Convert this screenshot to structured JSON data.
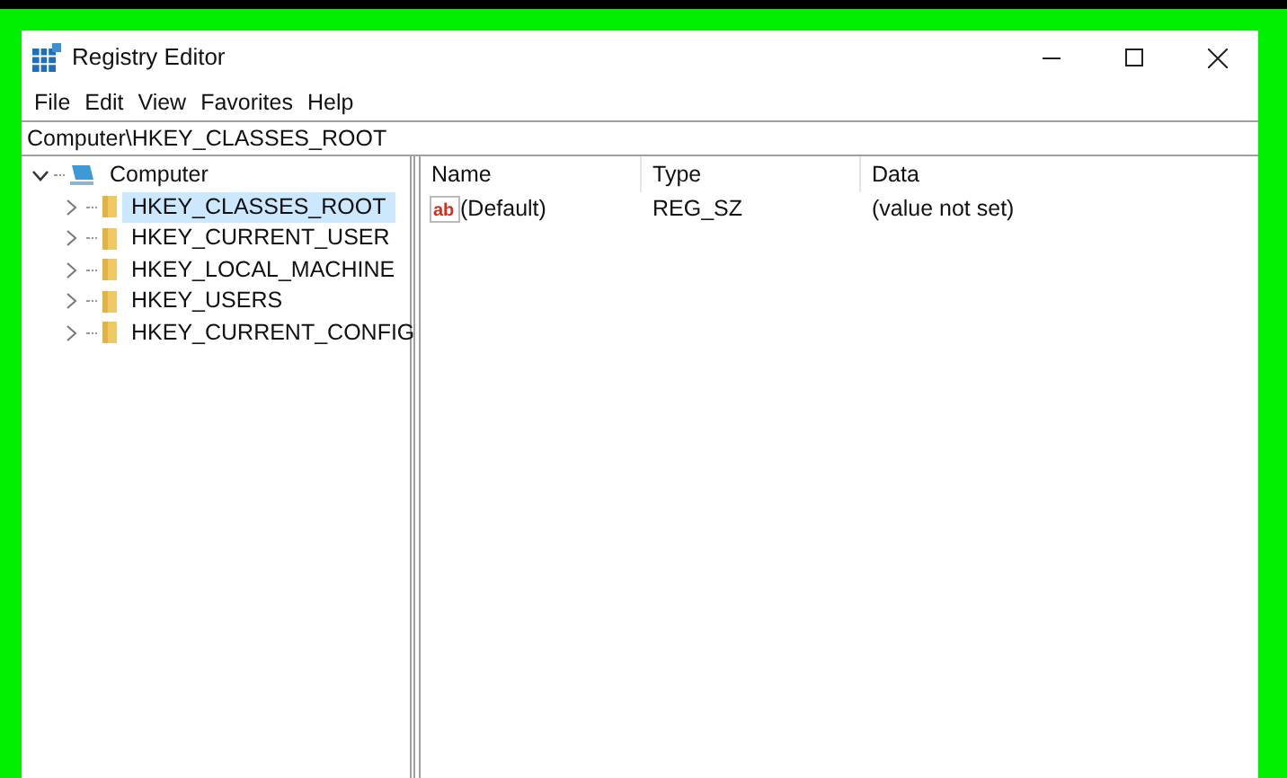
{
  "window": {
    "title": "Registry Editor"
  },
  "menu": [
    "File",
    "Edit",
    "View",
    "Favorites",
    "Help"
  ],
  "address_bar": {
    "value": "Computer\\HKEY_CLASSES_ROOT"
  },
  "tree": [
    {
      "label": "Computer",
      "kind": "computer",
      "expanded": true,
      "selected": false,
      "children": [
        {
          "label": "HKEY_CLASSES_ROOT",
          "kind": "folder",
          "expanded": false,
          "selected": true
        },
        {
          "label": "HKEY_CURRENT_USER",
          "kind": "folder",
          "expanded": false,
          "selected": false
        },
        {
          "label": "HKEY_LOCAL_MACHINE",
          "kind": "folder",
          "expanded": false,
          "selected": false
        },
        {
          "label": "HKEY_USERS",
          "kind": "folder",
          "expanded": false,
          "selected": false
        },
        {
          "label": "HKEY_CURRENT_CONFIG",
          "kind": "folder",
          "expanded": false,
          "selected": false
        }
      ]
    }
  ],
  "table": {
    "columns": [
      "Name",
      "Type",
      "Data"
    ],
    "rows": [
      {
        "icon_text": "ab",
        "name": "(Default)",
        "type": "REG_SZ",
        "data": "(value not set)"
      }
    ]
  }
}
